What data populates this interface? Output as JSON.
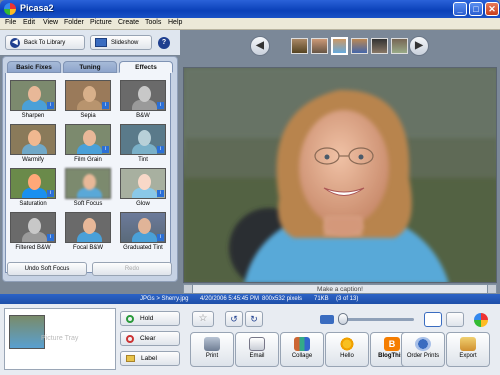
{
  "window": {
    "title": "Picasa2",
    "controls": {
      "minimize": "_",
      "maximize": "□",
      "close": "✕"
    }
  },
  "menu": [
    "File",
    "Edit",
    "View",
    "Folder",
    "Picture",
    "Create",
    "Tools",
    "Help"
  ],
  "toolbar": {
    "back_label": "Back To Library",
    "slideshow_label": "Slideshow",
    "help_label": "?"
  },
  "tabs": [
    "Basic Fixes",
    "Tuning",
    "Effects"
  ],
  "effects": [
    {
      "label": "Sharpen",
      "style": "normal",
      "badge": true
    },
    {
      "label": "Sepia",
      "style": "sepia",
      "badge": true
    },
    {
      "label": "B&W",
      "style": "bw",
      "badge": true
    },
    {
      "label": "Warmify",
      "style": "warm",
      "badge": false
    },
    {
      "label": "Film Grain",
      "style": "normal",
      "badge": true
    },
    {
      "label": "Tint",
      "style": "tint",
      "badge": true
    },
    {
      "label": "Saturation",
      "style": "sat",
      "badge": true
    },
    {
      "label": "Soft Focus",
      "style": "soft",
      "badge": false
    },
    {
      "label": "Glow",
      "style": "glow",
      "badge": true
    },
    {
      "label": "Filtered B&W",
      "style": "bw",
      "badge": true
    },
    {
      "label": "Focal B&W",
      "style": "focal",
      "badge": false
    },
    {
      "label": "Graduated Tint",
      "style": "grad",
      "badge": true
    }
  ],
  "panel_buttons": {
    "undo_label": "Undo Soft Focus",
    "redo_label": "Redo"
  },
  "photo": {
    "caption_placeholder": "Make a caption!"
  },
  "info": {
    "path": "JPGs > Sherry.jpg",
    "date": "4/20/2006 5:45:45 PM",
    "dimensions": "800x532 pixels",
    "size": "71KB",
    "position": "(3 of 13)"
  },
  "tray": {
    "label": "Picture Tray"
  },
  "tray_buttons": {
    "hold_label": "Hold",
    "clear_label": "Clear",
    "label_label": "Label"
  },
  "actions": [
    "Print",
    "Email",
    "Collage",
    "Hello",
    "BlogThis!",
    "Order Prints",
    "Export"
  ],
  "colors": {
    "titlebar": "#0a40b8",
    "accent": "#2b6fd6",
    "infobar": "#1e4fa8"
  }
}
